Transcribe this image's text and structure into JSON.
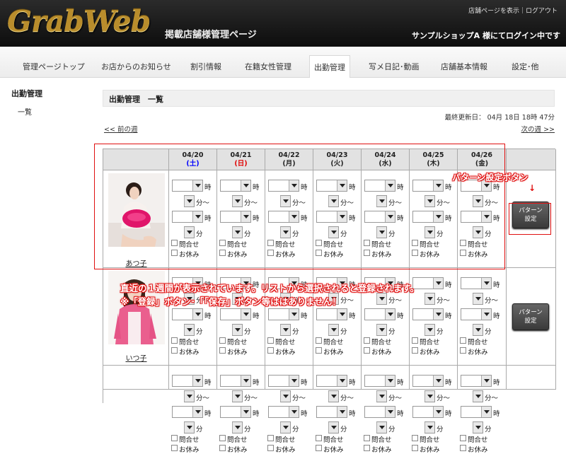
{
  "header": {
    "logo": "GrabWeb",
    "subtitle": "掲載店舗様管理ページ",
    "links": {
      "shop_page": "店舗ページを表示",
      "separator": "｜",
      "logout": "ログアウト"
    },
    "login_status": "サンプルショップA 様にてログイン中です"
  },
  "nav": {
    "items": [
      {
        "label": "管理ページトップ",
        "active": false
      },
      {
        "label": "お店からのお知らせ",
        "active": false
      },
      {
        "label": "割引情報",
        "active": false
      },
      {
        "label": "在籍女性管理",
        "active": false
      },
      {
        "label": "出勤管理",
        "active": true
      },
      {
        "label": "写メ日記･動画",
        "active": false
      },
      {
        "label": "店舗基本情報",
        "active": false
      },
      {
        "label": "設定･他",
        "active": false
      }
    ]
  },
  "sidebar": {
    "title": "出勤管理",
    "items": [
      {
        "label": "一覧"
      }
    ]
  },
  "main": {
    "title": "出勤管理　一覧",
    "updated": "最終更新日： 04月 18日 18時 47分",
    "prev": "<< 前の週",
    "next": "次の週 >>"
  },
  "table": {
    "days": [
      {
        "date": "04/20",
        "dow": "(土)",
        "type": "sat"
      },
      {
        "date": "04/21",
        "dow": "(日)",
        "type": "sun"
      },
      {
        "date": "04/22",
        "dow": "(月)",
        "type": "weekday"
      },
      {
        "date": "04/23",
        "dow": "(火)",
        "type": "weekday"
      },
      {
        "date": "04/24",
        "dow": "(水)",
        "type": "weekday"
      },
      {
        "date": "04/25",
        "dow": "(木)",
        "type": "weekday"
      },
      {
        "date": "04/26",
        "dow": "(金)",
        "type": "weekday"
      }
    ],
    "units": {
      "hour": "時",
      "minute_to": "分〜",
      "minute": "分"
    },
    "checkboxes": {
      "inquiry": "問合せ",
      "rest": "お休み"
    },
    "rows": [
      {
        "name": "あつ子"
      },
      {
        "name": "いつ子"
      },
      {
        "name": ""
      }
    ],
    "pattern_button": "パターン\n設定"
  },
  "annotations": {
    "pattern_label": "パターン設定ボタン",
    "arrow": "↓",
    "line1": "直近の１週間が表示されています。リストから選択されると登録されます。",
    "line2": "※「登録」ボタン･「｢保存」ボタン等ははありません！",
    "color": "#e01010"
  }
}
